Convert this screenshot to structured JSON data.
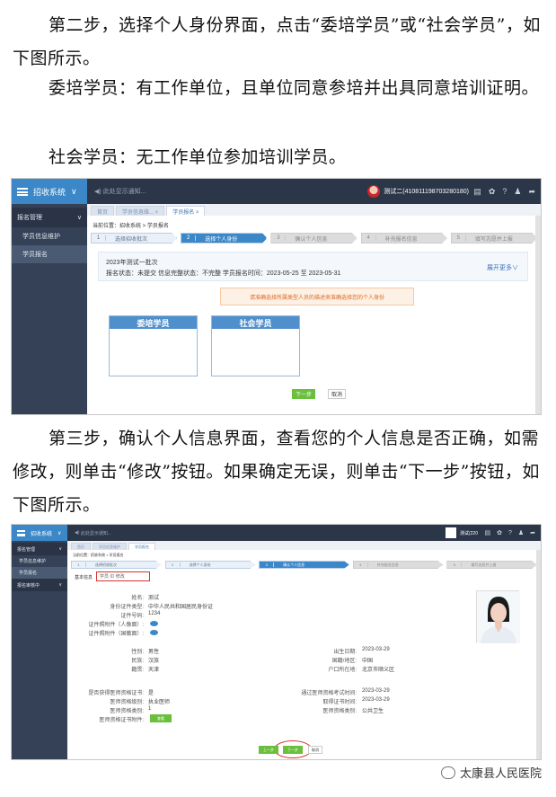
{
  "paragraphs": {
    "p1": "第二步，选择个人身份界面，点击“委培学员”或“社会学员”，如下图所示。",
    "p2": "委培学员：有工作单位，且单位同意参培并出具同意培训证明。",
    "p3": "社会学员：无工作单位参加培训学员。",
    "p4": "第三步，确认个人信息界面，查看您的个人信息是否正确，如需修改，则单击“修改”按钮。如果确定无误，则单击“下一步”按钮，如下图所示。"
  },
  "shot1": {
    "system": "招收系统",
    "notice": "此处显示通知...",
    "user": "测试二(410811198703280180)",
    "tabs": [
      "首页",
      "学员信息维... ×",
      "学员报名 ×"
    ],
    "side": {
      "group": "报名管理",
      "items": [
        "学员信息维护",
        "学员报名"
      ]
    },
    "crumb": "当前位置：招收系统 > 学员报名",
    "steps": [
      {
        "n": "1",
        "label": "选择招收批次"
      },
      {
        "n": "2",
        "label": "选择个人身份"
      },
      {
        "n": "3",
        "label": "确认个人信息"
      },
      {
        "n": "4",
        "label": "补充报名信息"
      },
      {
        "n": "5",
        "label": "填写志愿并上报"
      }
    ],
    "batch_title": "2023年测试一批次",
    "batch_info": "报名状态：未提交    信息完整状态：不完整    学员报名时间：2023-05-25 至 2023-05-31",
    "expand": "展开更多∨",
    "warning": "请准确选择所属类型人员的描述来准确选择您的个人身份",
    "card1": "委培学员",
    "card2": "社会学员",
    "next": "下一步",
    "cancel": "取消"
  },
  "shot2": {
    "system": "招收系统",
    "notice": "此处显示通知...",
    "user": "测试(220",
    "tabs": [
      "首页",
      "学员信息维护",
      "学员报名"
    ],
    "side": {
      "group": "报名管理",
      "items": [
        "学员信息维护",
        "学员报名"
      ],
      "group2": "报名审核中"
    },
    "crumb": "当前位置：招收系统 > 学员报名",
    "steps": [
      {
        "n": "1",
        "label": "选择招收批次"
      },
      {
        "n": "2",
        "label": "选择个人身份"
      },
      {
        "n": "3",
        "label": "确认个人信息"
      },
      {
        "n": "4",
        "label": "补充报名信息"
      },
      {
        "n": "5",
        "label": "填写志愿并上报"
      }
    ],
    "basic_tab": "基本信息",
    "edit_row": "学员 ID    修改",
    "fields_left": [
      {
        "k": "姓名:",
        "v": "测试"
      },
      {
        "k": "身份证件类型:",
        "v": "中华人民共和国居民身份证"
      },
      {
        "k": "证件号码:",
        "v": "1234"
      },
      {
        "k": "证件照附件（人像面）:",
        "v": ""
      },
      {
        "k": "证件照附件（国徽面）:",
        "v": ""
      }
    ],
    "fields_mid_left": [
      {
        "k": "性别:",
        "v": "男性"
      },
      {
        "k": "民族:",
        "v": "汉族"
      },
      {
        "k": "籍贯:",
        "v": "天津"
      }
    ],
    "fields_mid_right": [
      {
        "k": "出生日期:",
        "v": "2023-03-29"
      },
      {
        "k": "国籍/地区:",
        "v": "中国"
      },
      {
        "k": "户口所在地:",
        "v": "北京市顺义区"
      }
    ],
    "fields_low_left": [
      {
        "k": "是否获得医师资格证书:",
        "v": "是"
      },
      {
        "k": "医师资格级别:",
        "v": "执业医师"
      },
      {
        "k": "医师资格类别:",
        "v": "1"
      },
      {
        "k": "医师资格证书附件:",
        "v": ""
      }
    ],
    "fields_low_right": [
      {
        "k": "通过医师资格考试时间:",
        "v": "2023-03-29"
      },
      {
        "k": "取得证书时间:",
        "v": "2023-03-29"
      },
      {
        "k": "医师资格类别:",
        "v": "公共卫生"
      }
    ],
    "view_btn": "查看",
    "prev": "上一步",
    "next": "下一步",
    "cancel": "取消"
  },
  "watermark": "太康县人民医院"
}
